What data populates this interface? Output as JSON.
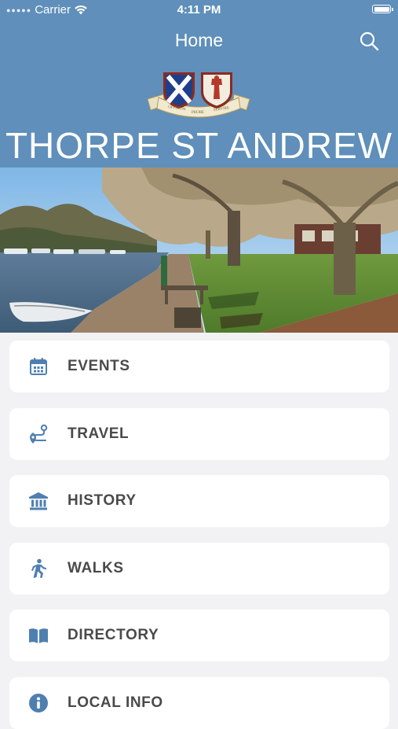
{
  "status_bar": {
    "carrier": "Carrier",
    "time": "4:11 PM"
  },
  "header": {
    "title": "Home",
    "town_name": "THORPE ST ANDREW",
    "crest_motto": [
      "OPPIDUM",
      "PROBE",
      "SERVIRE"
    ],
    "background_color": "#5f8fba"
  },
  "menu": {
    "items": [
      {
        "label": "EVENTS",
        "icon": "calendar-icon"
      },
      {
        "label": "TRAVEL",
        "icon": "route-icon"
      },
      {
        "label": "HISTORY",
        "icon": "museum-icon"
      },
      {
        "label": "WALKS",
        "icon": "walking-icon"
      },
      {
        "label": "DIRECTORY",
        "icon": "book-icon"
      },
      {
        "label": "LOCAL INFO",
        "icon": "info-icon"
      }
    ],
    "icon_color": "#4f7fb0"
  }
}
